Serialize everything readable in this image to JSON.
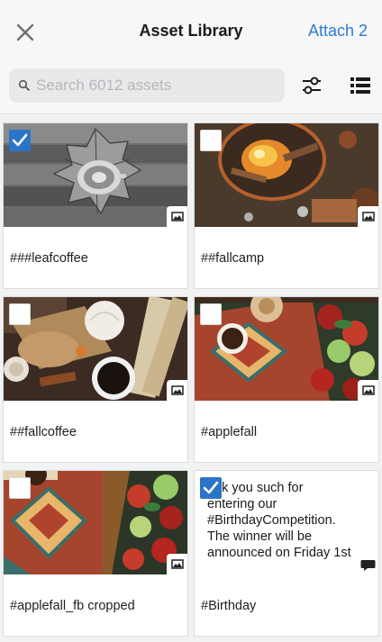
{
  "header": {
    "title": "Asset Library",
    "attach_label": "Attach 2"
  },
  "search": {
    "placeholder": "Search 6012 assets"
  },
  "assets": [
    {
      "label": "###leafcoffee",
      "selected": true,
      "kind": "image",
      "badge_icon": "image-icon"
    },
    {
      "label": "##fallcamp",
      "selected": false,
      "kind": "image",
      "badge_icon": "image-icon"
    },
    {
      "label": "##fallcoffee",
      "selected": false,
      "kind": "image",
      "badge_icon": "image-icon"
    },
    {
      "label": "#applefall",
      "selected": false,
      "kind": "image",
      "badge_icon": "image-icon"
    },
    {
      "label": "#applefall_fb cropped",
      "selected": false,
      "kind": "image",
      "badge_icon": "image-icon"
    },
    {
      "label": "#Birthday",
      "selected": true,
      "kind": "text",
      "badge_icon": "comment-icon",
      "text_preview": "ank you such for\nentering our\n#BirthdayCompetition.\nThe winner will be\nannounced on Friday 1st"
    }
  ],
  "colors": {
    "accent": "#2b75c8",
    "link": "#2f7bd3"
  }
}
